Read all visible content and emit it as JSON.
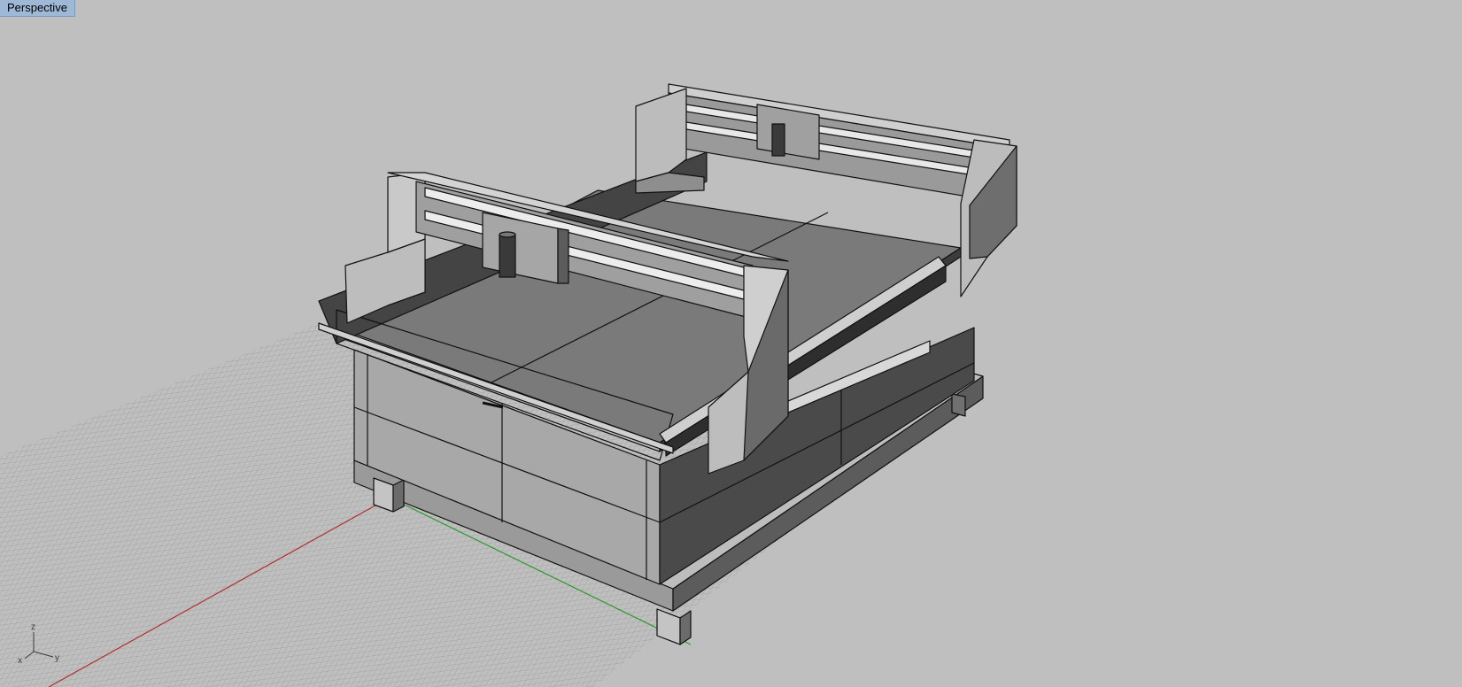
{
  "viewport": {
    "title": "Perspective",
    "background": "#bfbfbf",
    "grid_color": "#9a9a9a",
    "x_axis_color": "#b03030",
    "y_axis_color": "#2e9a2e"
  },
  "axes_gizmo": {
    "x_label": "x",
    "y_label": "y",
    "z_label": "z"
  },
  "model": {
    "kind": "cnc-router-table",
    "gantry_count": 2
  }
}
